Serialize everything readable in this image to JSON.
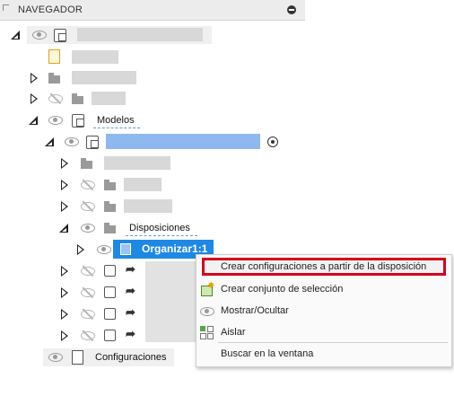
{
  "navigator": {
    "title": "NAVEGADOR"
  },
  "tree": {
    "modelos_label": "Modelos",
    "disposiciones_label": "Disposiciones",
    "selected_label": "Organizar1:1",
    "configuraciones_label": "Configuraciones"
  },
  "context_menu": {
    "items": [
      {
        "label": "Crear configuraciones a partir de la disposición",
        "icon": "none"
      },
      {
        "label": "Crear conjunto de selección",
        "icon": "selection-set-icon"
      },
      {
        "label": "Mostrar/Ocultar",
        "icon": "eye-icon"
      },
      {
        "label": "Aislar",
        "icon": "isolate-icon"
      },
      {
        "label": "Buscar en la ventana",
        "icon": "none"
      }
    ]
  },
  "colors": {
    "selection": "#1e88e5",
    "highlight_border": "#d6001c"
  }
}
